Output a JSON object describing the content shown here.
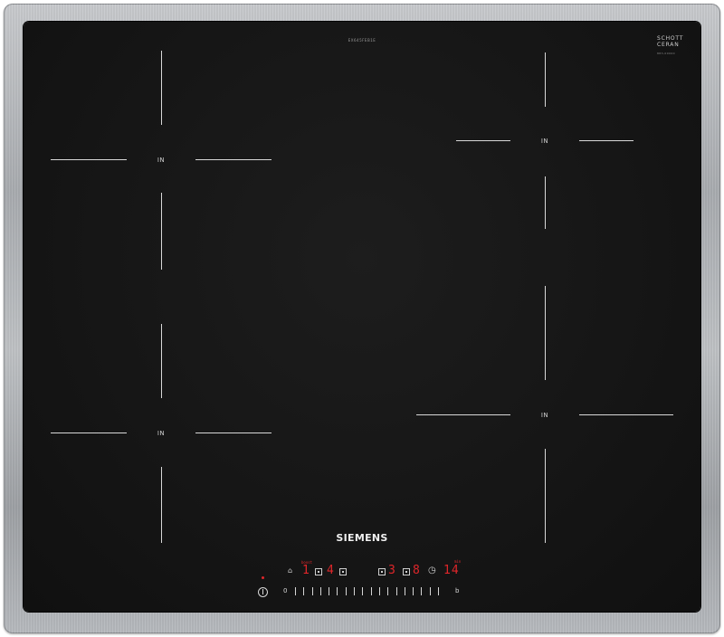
{
  "cooktop": {
    "model_code": "EX645FEB1E",
    "glass_brand_top": "SCHOTT",
    "glass_brand_bottom": "CERAN",
    "glass_serial": "883-00000",
    "brand": "SIEMENS",
    "zones": [
      {
        "label": "IN"
      },
      {
        "label": "IN"
      },
      {
        "label": "IN"
      },
      {
        "label": "IN"
      }
    ]
  },
  "controls": {
    "zone_displays": [
      {
        "value": "1"
      },
      {
        "value": "4"
      },
      {
        "value": "3"
      },
      {
        "value": "8"
      }
    ],
    "timer_display": "14",
    "timer_unit": "min",
    "boost_label": "boost",
    "slider_min_label": "0",
    "slider_max_label": "b",
    "colors": {
      "display": "#e0262a",
      "glass": "#151515",
      "markings": "#d8d8d8"
    }
  }
}
